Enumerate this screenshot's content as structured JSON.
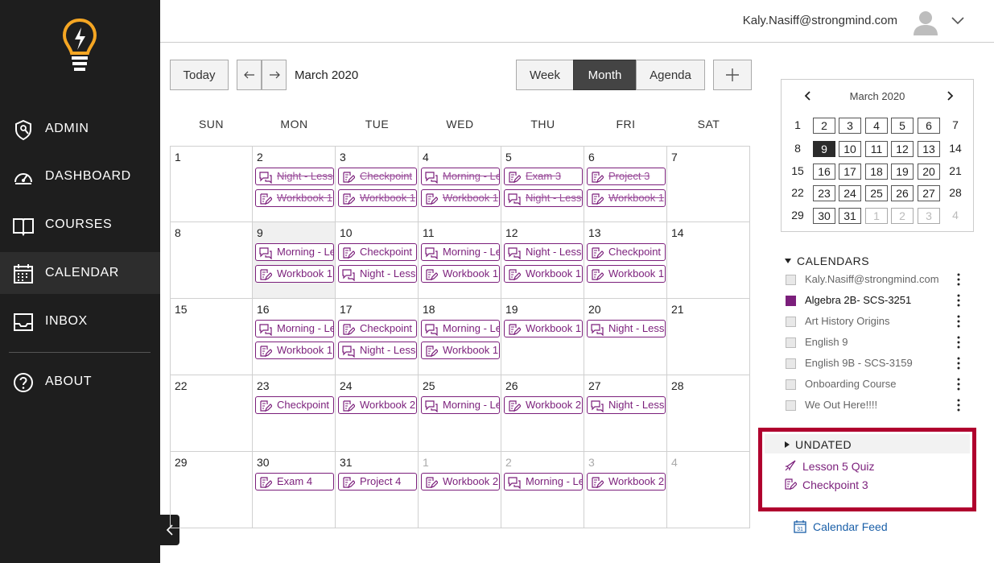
{
  "sidebar": {
    "items": [
      {
        "label": "ADMIN",
        "icon": "admin-shield-icon"
      },
      {
        "label": "DASHBOARD",
        "icon": "dashboard-gauge-icon"
      },
      {
        "label": "COURSES",
        "icon": "book-icon"
      },
      {
        "label": "CALENDAR",
        "icon": "calendar-icon",
        "active": true
      },
      {
        "label": "INBOX",
        "icon": "inbox-icon"
      },
      {
        "label": "ABOUT",
        "icon": "question-icon"
      }
    ]
  },
  "header": {
    "email": "Kaly.Nasiff@strongmind.com"
  },
  "toolbar": {
    "today": "Today",
    "month_label": "March 2020",
    "views": [
      "Week",
      "Month",
      "Agenda"
    ],
    "active_view": "Month"
  },
  "calendar": {
    "weekdays": [
      "SUN",
      "MON",
      "TUE",
      "WED",
      "THU",
      "FRI",
      "SAT"
    ],
    "weeks": [
      [
        {
          "day": "1",
          "events": []
        },
        {
          "day": "2",
          "events": [
            {
              "title": "Night - Lesson",
              "icon": "chat",
              "done": true
            },
            {
              "title": "Workbook 1",
              "icon": "edit",
              "done": true
            }
          ]
        },
        {
          "day": "3",
          "events": [
            {
              "title": "Checkpoint",
              "icon": "edit",
              "done": true
            },
            {
              "title": "Workbook 1",
              "icon": "edit",
              "done": true
            }
          ]
        },
        {
          "day": "4",
          "events": [
            {
              "title": "Morning - Lesson",
              "icon": "chat",
              "done": true
            },
            {
              "title": "Workbook 1",
              "icon": "edit",
              "done": true
            }
          ]
        },
        {
          "day": "5",
          "events": [
            {
              "title": "Exam 3",
              "icon": "edit",
              "done": true
            },
            {
              "title": "Night - Lesson",
              "icon": "chat",
              "done": true
            }
          ]
        },
        {
          "day": "6",
          "events": [
            {
              "title": "Project 3",
              "icon": "edit",
              "done": true
            },
            {
              "title": "Workbook 1",
              "icon": "edit",
              "done": true
            }
          ]
        },
        {
          "day": "7",
          "events": []
        }
      ],
      [
        {
          "day": "8",
          "events": []
        },
        {
          "day": "9",
          "today": true,
          "events": [
            {
              "title": "Morning - Lesson",
              "icon": "chat"
            },
            {
              "title": "Workbook 1",
              "icon": "edit"
            }
          ]
        },
        {
          "day": "10",
          "events": [
            {
              "title": "Checkpoint",
              "icon": "edit"
            },
            {
              "title": "Night - Lesson",
              "icon": "chat"
            }
          ]
        },
        {
          "day": "11",
          "events": [
            {
              "title": "Morning - Lesson",
              "icon": "chat"
            },
            {
              "title": "Workbook 1",
              "icon": "edit"
            }
          ]
        },
        {
          "day": "12",
          "events": [
            {
              "title": "Night - Lesson",
              "icon": "chat"
            },
            {
              "title": "Workbook 1",
              "icon": "edit"
            }
          ]
        },
        {
          "day": "13",
          "events": [
            {
              "title": "Checkpoint",
              "icon": "edit"
            },
            {
              "title": "Workbook 1",
              "icon": "edit"
            }
          ]
        },
        {
          "day": "14",
          "events": []
        }
      ],
      [
        {
          "day": "15",
          "events": []
        },
        {
          "day": "16",
          "events": [
            {
              "title": "Morning - Lesson",
              "icon": "chat"
            },
            {
              "title": "Workbook 1",
              "icon": "edit"
            }
          ]
        },
        {
          "day": "17",
          "events": [
            {
              "title": "Checkpoint",
              "icon": "edit"
            },
            {
              "title": "Night - Lesson",
              "icon": "chat"
            }
          ]
        },
        {
          "day": "18",
          "events": [
            {
              "title": "Morning - Lesson",
              "icon": "chat"
            },
            {
              "title": "Workbook 1",
              "icon": "edit"
            }
          ]
        },
        {
          "day": "19",
          "events": [
            {
              "title": "Workbook 1",
              "icon": "edit"
            }
          ]
        },
        {
          "day": "20",
          "events": [
            {
              "title": "Night - Lesson",
              "icon": "chat"
            }
          ]
        },
        {
          "day": "21",
          "events": []
        }
      ],
      [
        {
          "day": "22",
          "events": []
        },
        {
          "day": "23",
          "events": [
            {
              "title": "Checkpoint",
              "icon": "edit"
            }
          ]
        },
        {
          "day": "24",
          "events": [
            {
              "title": "Workbook 2",
              "icon": "edit"
            }
          ]
        },
        {
          "day": "25",
          "events": [
            {
              "title": "Morning - Lesson",
              "icon": "chat"
            }
          ]
        },
        {
          "day": "26",
          "events": [
            {
              "title": "Workbook 2",
              "icon": "edit"
            }
          ]
        },
        {
          "day": "27",
          "events": [
            {
              "title": "Night - Lesson",
              "icon": "chat"
            }
          ]
        },
        {
          "day": "28",
          "events": []
        }
      ],
      [
        {
          "day": "29",
          "events": []
        },
        {
          "day": "30",
          "events": [
            {
              "title": "Exam 4",
              "icon": "edit"
            }
          ]
        },
        {
          "day": "31",
          "events": [
            {
              "title": "Project 4",
              "icon": "edit"
            }
          ]
        },
        {
          "day": "1",
          "other": true,
          "events": [
            {
              "title": "Workbook 2",
              "icon": "edit"
            }
          ]
        },
        {
          "day": "2",
          "other": true,
          "events": [
            {
              "title": "Morning - Lesson",
              "icon": "chat"
            }
          ]
        },
        {
          "day": "3",
          "other": true,
          "events": [
            {
              "title": "Workbook 2",
              "icon": "edit"
            }
          ]
        },
        {
          "day": "4",
          "other": true,
          "events": []
        }
      ]
    ]
  },
  "mini_calendar": {
    "title": "March 2020",
    "weeks": [
      [
        "1",
        "2",
        "3",
        "4",
        "5",
        "6",
        "7"
      ],
      [
        "8",
        "9",
        "10",
        "11",
        "12",
        "13",
        "14"
      ],
      [
        "15",
        "16",
        "17",
        "18",
        "19",
        "20",
        "21"
      ],
      [
        "22",
        "23",
        "24",
        "25",
        "26",
        "27",
        "28"
      ],
      [
        "29",
        "30",
        "31",
        "1",
        "2",
        "3",
        "4"
      ]
    ],
    "selected": "9"
  },
  "calendars": {
    "title": "CALENDARS",
    "items": [
      {
        "name": "Kaly.Nasiff@strongmind.com",
        "checked": false,
        "color": "#e8e8e8"
      },
      {
        "name": "Algebra 2B- SCS-3251",
        "checked": true,
        "color": "#7b1f7b"
      },
      {
        "name": "Art History Origins",
        "checked": false,
        "color": "#e8e8e8"
      },
      {
        "name": "English 9",
        "checked": false,
        "color": "#e8e8e8"
      },
      {
        "name": "English 9B - SCS-3159",
        "checked": false,
        "color": "#e8e8e8"
      },
      {
        "name": "Onboarding Course",
        "checked": false,
        "color": "#e8e8e8"
      },
      {
        "name": "We Out Here!!!!",
        "checked": false,
        "color": "#e8e8e8"
      }
    ]
  },
  "undated": {
    "title": "UNDATED",
    "items": [
      {
        "title": "Lesson 5 Quiz",
        "icon": "quiz-rocket-icon"
      },
      {
        "title": "Checkpoint 3",
        "icon": "edit"
      }
    ]
  },
  "feed": {
    "label": "Calendar Feed"
  },
  "colors": {
    "accent": "#7b1f7b",
    "highlight": "#b0002e",
    "link": "#1a5fa8"
  }
}
